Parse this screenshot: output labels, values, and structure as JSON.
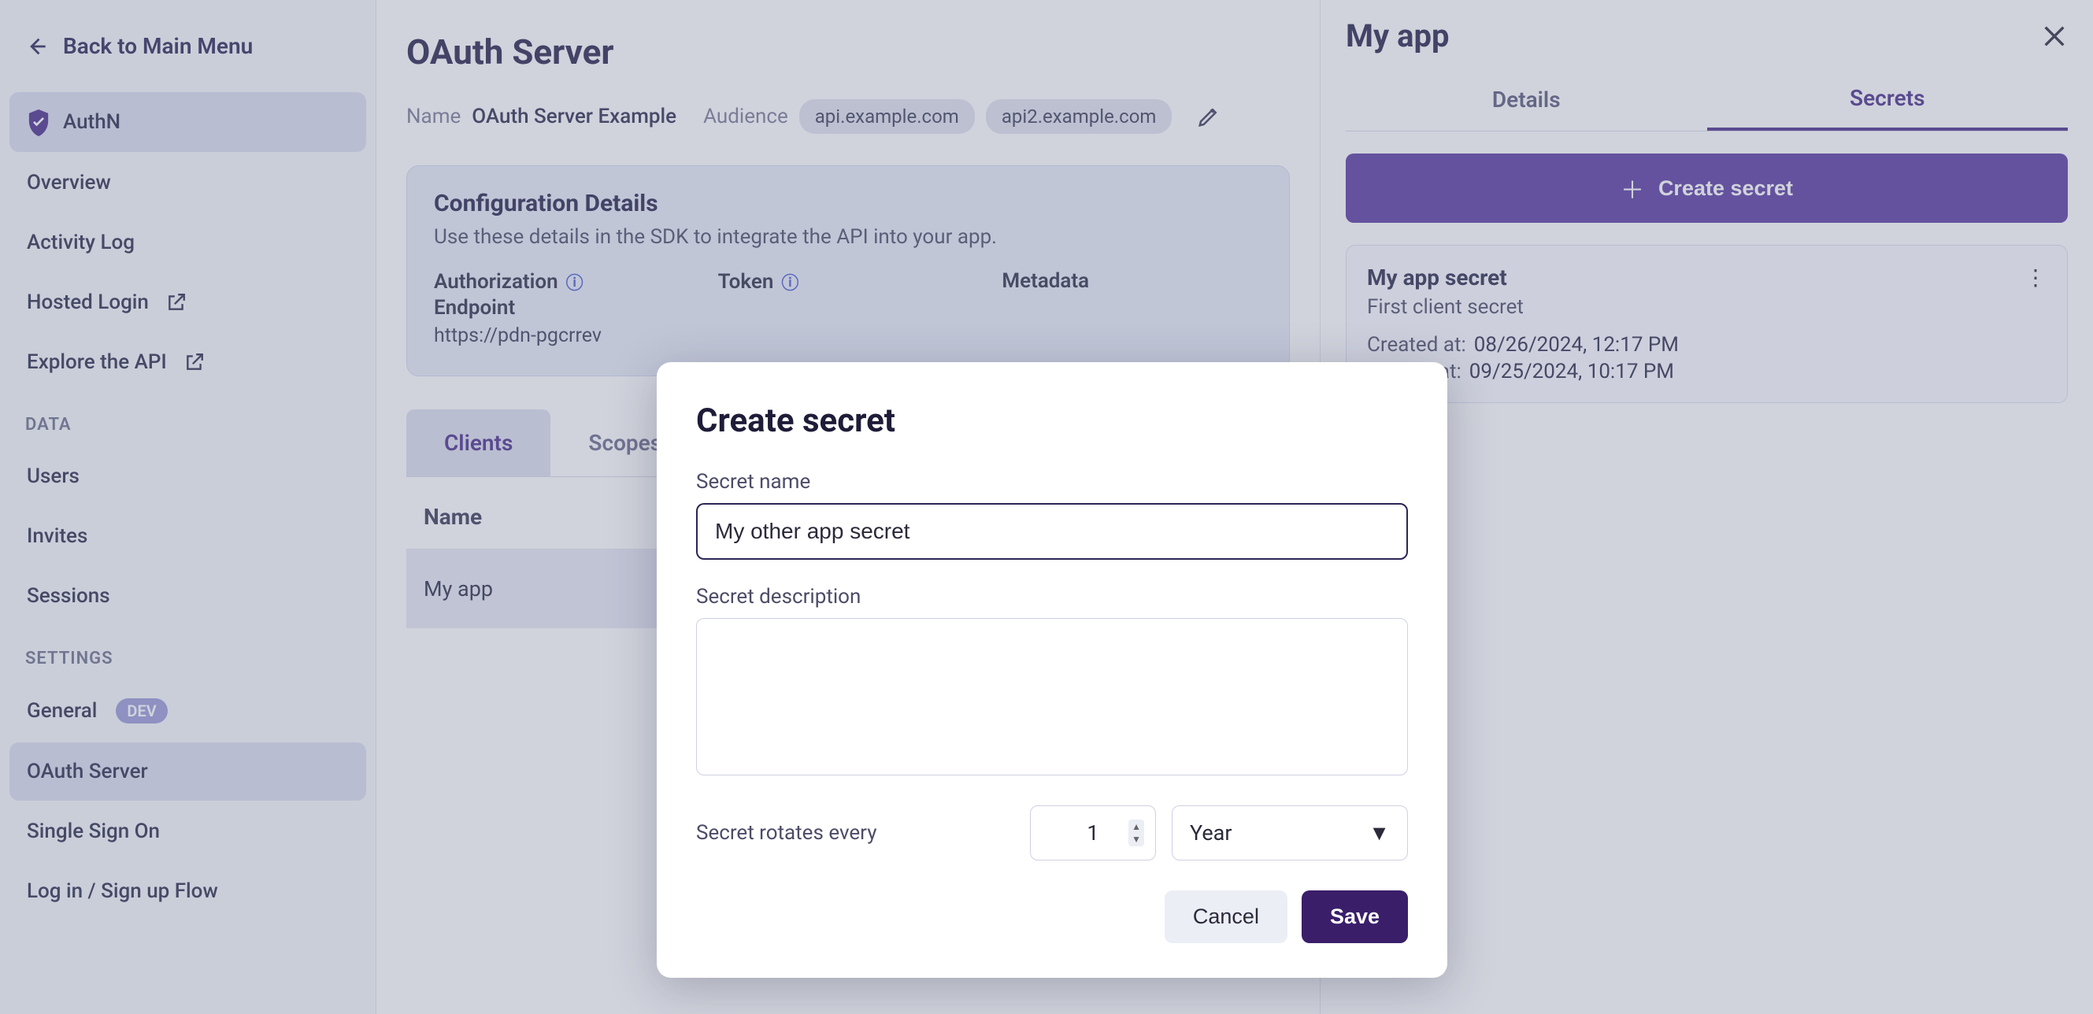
{
  "sidebar": {
    "back_label": "Back to Main Menu",
    "brand": "AuthN",
    "nav1": [
      {
        "label": "Overview"
      },
      {
        "label": "Activity Log"
      },
      {
        "label": "Hosted Login",
        "external": true
      },
      {
        "label": "Explore the API",
        "external": true
      }
    ],
    "section_data": "DATA",
    "nav_data": [
      {
        "label": "Users"
      },
      {
        "label": "Invites"
      },
      {
        "label": "Sessions"
      }
    ],
    "section_settings": "SETTINGS",
    "nav_settings": [
      {
        "label": "General",
        "badge": "DEV"
      },
      {
        "label": "OAuth Server",
        "active": true
      },
      {
        "label": "Single Sign On"
      },
      {
        "label": "Log in / Sign up Flow"
      }
    ]
  },
  "main": {
    "title": "OAuth Server",
    "meta": {
      "name_label": "Name",
      "name_value": "OAuth Server Example",
      "aud_label": "Audience",
      "aud_chips": [
        "api.example.com",
        "api2.example.com"
      ]
    },
    "config": {
      "heading": "Configuration Details",
      "subtitle": "Use these details in the SDK to integrate the API into your app.",
      "cols": {
        "auth_label": "Authorization",
        "auth_sub": "Endpoint",
        "auth_val": "https://pdn-pgcrrev",
        "token_label": "Token",
        "meta_label": "Metadata"
      }
    },
    "tabs": {
      "clients": "Clients",
      "scopes": "Scopes"
    },
    "table": {
      "header_name": "Name",
      "row_name": "My app"
    }
  },
  "right": {
    "title": "My app",
    "tabs": {
      "details": "Details",
      "secrets": "Secrets"
    },
    "create_btn": "Create secret",
    "secret": {
      "name": "My app secret",
      "desc": "First client secret",
      "created_label": "Created at:",
      "created_val": "08/26/2024, 12:17 PM",
      "expires_label": "Expires at:",
      "expires_val": "09/25/2024, 10:17 PM"
    }
  },
  "modal": {
    "title": "Create secret",
    "name_label": "Secret name",
    "name_value": "My other app secret",
    "desc_label": "Secret description",
    "desc_value": "",
    "rotate_label": "Secret rotates every",
    "rotate_num": "1",
    "rotate_unit": "Year",
    "cancel": "Cancel",
    "save": "Save"
  }
}
